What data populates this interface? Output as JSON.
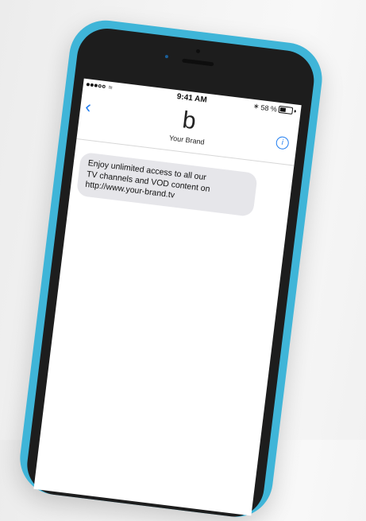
{
  "status": {
    "time": "9:41 AM",
    "battery_label": "58 %",
    "battery_level": 0.58
  },
  "nav": {
    "back_icon": "chevron-left-icon",
    "brand_logo": "b",
    "brand_name": "Your Brand",
    "info_icon": "info-icon"
  },
  "messages": [
    {
      "text": "Enjoy unlimited access to all our\nTV channels and VOD content on\nhttp://www.your-brand.tv"
    }
  ],
  "colors": {
    "case": "#3fb5d8",
    "accent": "#1e7cf0",
    "bubble": "#e6e6ea"
  }
}
